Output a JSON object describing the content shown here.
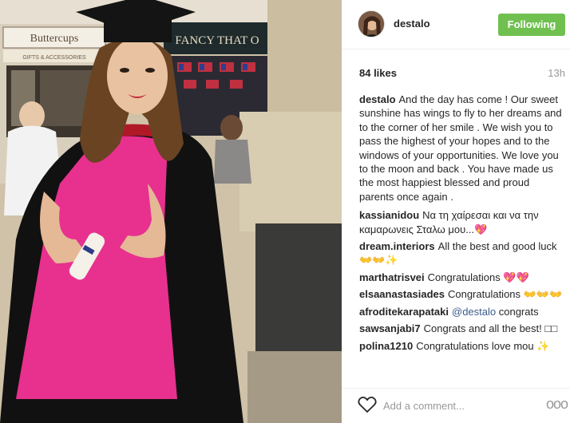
{
  "post": {
    "photo_signs": {
      "shop_left": "Buttercups",
      "shop_left_sub": "GIFTS & ACCESSORIES",
      "shop_right": "FANCY THAT O"
    }
  },
  "header": {
    "username": "destalo",
    "follow_label": "Following",
    "avatar_icon": "profile-avatar-icon",
    "follow_color": "#70c050"
  },
  "meta": {
    "likes": "84 likes",
    "time": "13h"
  },
  "comments": [
    {
      "author": "destalo",
      "text": "And the day has come ! Our sweet sunshine has wings to fly to her dreams and to the corner of her smile . We wish you to pass the highest of your hopes and to the windows of your opportunities. We love you to the moon and back . You have made us the most happiest blessed and proud parents once again ."
    },
    {
      "author": "kassianidou",
      "text": "Να τη χαίρεσαι και να την καμαρωνεις Σταλω μου...💖"
    },
    {
      "author": "dream.interiors",
      "text": "All the best and good luck 👐👐✨"
    },
    {
      "author": "marthatrisvei",
      "text": "Congratulations 💖💖"
    },
    {
      "author": "elsaanastasiades",
      "text": "Congratulations 👐👐👐"
    },
    {
      "author": "afroditekarapataki",
      "mention": "@destalo",
      "text": " congrats"
    },
    {
      "author": "sawsanjabi7",
      "text": "Congrats and all the best! □□"
    },
    {
      "author": "polina1210",
      "text": "Congratulations love mou ✨"
    }
  ],
  "footer": {
    "comment_placeholder": "Add a comment...",
    "more_label": "ooo",
    "heart_icon": "heart-outline-icon",
    "more_icon": "more-options-icon"
  }
}
